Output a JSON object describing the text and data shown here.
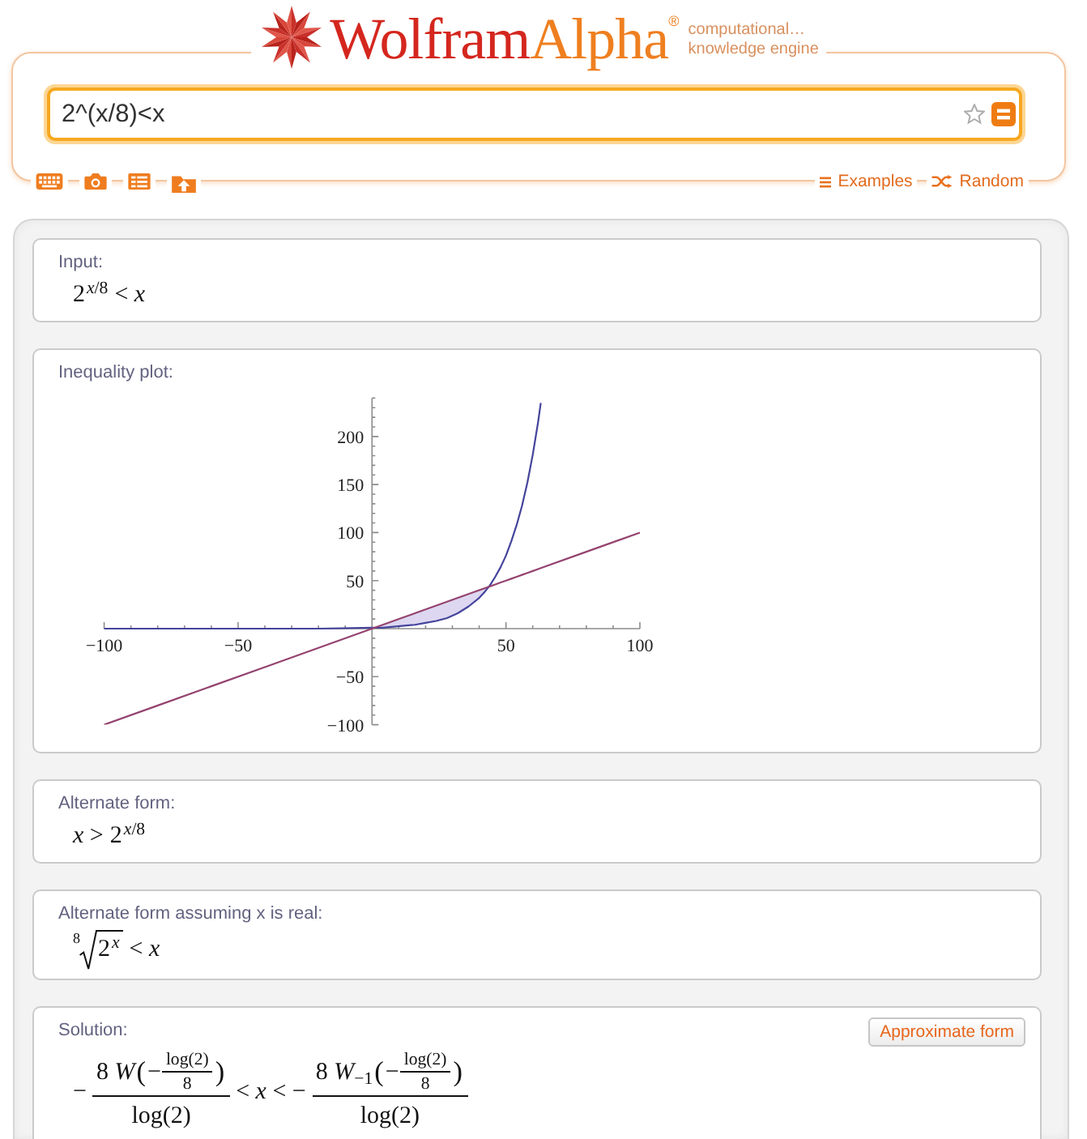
{
  "logo": {
    "wordmark": [
      "Wolfram",
      "Alpha$^{®}$"
    ],
    "tagline": [
      "computational…",
      "knowledge engine"
    ]
  },
  "search": {
    "value": "2^(x/8)<x"
  },
  "links": [
    {
      "kind": "examples",
      "label": "Examples"
    },
    {
      "kind": "random",
      "label": "Random"
    }
  ],
  "pods": [
    {
      "kind": "formula",
      "title": "Input:",
      "formula": [
        {
          "kind": "power",
          "base": "2",
          "exponent": "*x*/8"
        },
        {
          "kind": "text",
          "text": "< *x*"
        }
      ]
    },
    {
      "kind": "plot",
      "title": "Inequality plot:",
      "chart_data": {
        "type": "line",
        "x": [
          -100,
          -80,
          -60,
          -40,
          -20,
          0,
          4,
          8,
          12,
          16,
          20,
          24,
          28,
          32,
          36,
          40,
          42,
          44,
          46,
          48,
          50,
          52,
          54,
          56,
          58,
          60,
          62,
          63,
          80,
          100
        ],
        "series": [
          {
            "color": "#44449c",
            "values": [
              0,
              0,
              0,
              0,
              0,
              1,
              1,
              2,
              3,
              4,
              6,
              8,
              11,
              16,
              23,
              32,
              38,
              45,
              54,
              64,
              76,
              91,
              108,
              128,
              152,
              181,
              215,
              235,
              null,
              null
            ]
          },
          {
            "color": "#94436f",
            "values": [
              -100,
              -80,
              -60,
              -40,
              -20,
              0,
              4,
              8,
              12,
              16,
              20,
              24,
              28,
              32,
              36,
              40,
              42,
              44,
              46,
              48,
              50,
              52,
              54,
              56,
              58,
              60,
              62,
              63,
              80,
              100
            ]
          }
        ],
        "xlim": [
          -100,
          100
        ],
        "ylim": [
          -100,
          240
        ],
        "xticks": [
          {
            "value": -100,
            "label": "−100"
          },
          {
            "value": -50,
            "label": "−50"
          },
          50,
          100
        ],
        "yticks": [
          {
            "value": -100,
            "label": "−100"
          },
          {
            "value": -50,
            "label": "−50"
          },
          50,
          100,
          150,
          200
        ]
      }
    },
    {
      "kind": "formula",
      "title": "Alternate form:",
      "formula": [
        {
          "kind": "text",
          "text": "*x* >"
        },
        {
          "kind": "power",
          "base": "2",
          "exponent": "*x*/8"
        }
      ]
    },
    {
      "kind": "formula",
      "title": "Alternate form assuming x is real:",
      "formula": [
        {
          "kind": "root",
          "index": "8",
          "radicand": [
            {
              "kind": "power",
              "base": "2",
              "exponent": "*x*"
            }
          ]
        },
        {
          "kind": "text",
          "text": "< *x*"
        }
      ]
    },
    {
      "kind": "formula",
      "title": "Solution:",
      "button": "Approximate form",
      "formula": [
        {
          "kind": "text",
          "text": "−"
        },
        {
          "kind": "fraction",
          "numerator": [
            {
              "kind": "text",
              "text": "8 *W*"
            },
            {
              "kind": "delimiter",
              "text": "("
            },
            {
              "kind": "text",
              "text": "−"
            },
            {
              "kind": "fraction",
              "numerator": [
                {
                  "kind": "text",
                  "text": "log(2)"
                }
              ],
              "denominator": [
                {
                  "kind": "text",
                  "text": "8"
                }
              ]
            },
            {
              "kind": "delimiter",
              "text": ")"
            }
          ],
          "denominator": [
            {
              "kind": "text",
              "text": "log(2)"
            }
          ]
        },
        {
          "kind": "text",
          "text": "< *x* < −"
        },
        {
          "kind": "fraction",
          "numerator": [
            {
              "kind": "text",
              "text": "8 *W*$_{−1}$"
            },
            {
              "kind": "delimiter",
              "text": "("
            },
            {
              "kind": "text",
              "text": "−"
            },
            {
              "kind": "fraction",
              "numerator": [
                {
                  "kind": "text",
                  "text": "log(2)"
                }
              ],
              "denominator": [
                {
                  "kind": "text",
                  "text": "8"
                }
              ]
            },
            {
              "kind": "delimiter",
              "text": ")"
            }
          ],
          "denominator": [
            {
              "kind": "text",
              "text": "log(2)"
            }
          ]
        }
      ]
    }
  ]
}
